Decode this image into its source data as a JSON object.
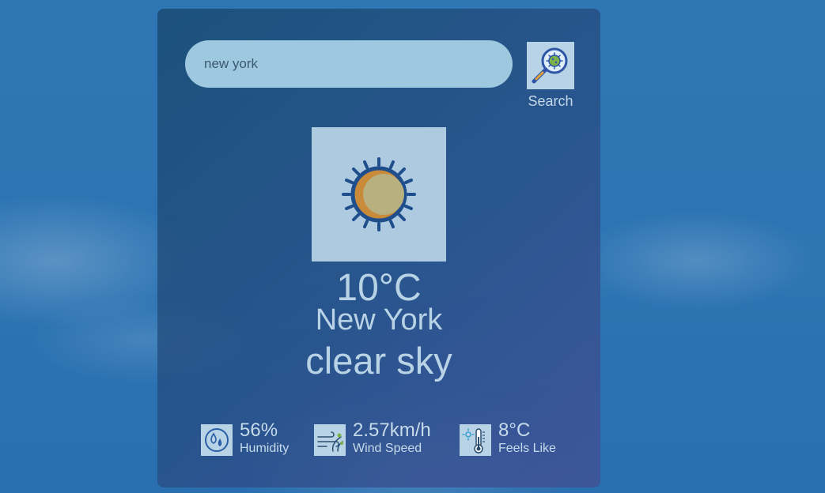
{
  "search": {
    "value": "new york",
    "placeholder": "",
    "button_label": "Search",
    "button_icon": "magnifier-virus-icon"
  },
  "current": {
    "icon": "sun-icon",
    "temperature": "10°C",
    "city": "New York",
    "description": "clear sky"
  },
  "stats": [
    {
      "value": "56%",
      "label": "Humidity",
      "icon": "humidity-icon"
    },
    {
      "value": "2.57km/h",
      "label": "Wind Speed",
      "icon": "wind-icon"
    },
    {
      "value": "8°C",
      "label": "Feels Like",
      "icon": "thermometer-icon"
    }
  ],
  "colors": {
    "sky_background": "#2f76b5",
    "card_background": "#2b4f80",
    "search_field": "#9ec8df",
    "icon_tile": "#b8d3e6",
    "text": "#b9d3e6",
    "sun_orange": "#c98a3a",
    "icon_stroke": "#1f4e8c"
  }
}
